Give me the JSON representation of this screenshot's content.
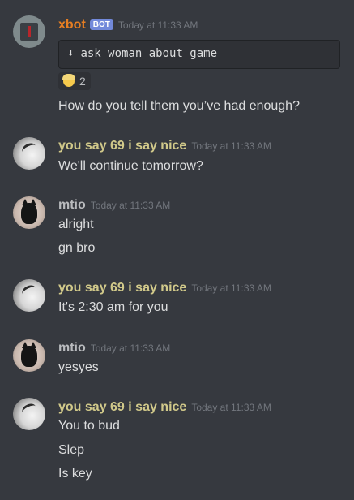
{
  "colors": {
    "background": "#36393f",
    "bot_name": "#e67e22",
    "user_name": "#d1c98a",
    "mtio_name": "#b9bbbe",
    "bot_tag": "#7289da",
    "timestamp": "#72767d"
  },
  "messages": [
    {
      "author": "xbot",
      "bot_tag": "BOT",
      "timestamp": "Today at 11:33 AM",
      "avatar_icon": "xbot-avatar",
      "codeblock": "ask woman about game",
      "codeblock_icon": "down-arrow-icon",
      "reaction": {
        "emoji_icon": "person-blonde-hair-emoji",
        "count": "2"
      },
      "lines": [
        "How do you tell them you’ve had enough?"
      ]
    },
    {
      "author": "you say 69 i say nice",
      "timestamp": "Today at 11:33 AM",
      "avatar_icon": "sheep-avatar",
      "lines": [
        "We'll continue tomorrow?"
      ]
    },
    {
      "author": "mtio",
      "timestamp": "Today at 11:33 AM",
      "avatar_icon": "cat-avatar",
      "lines": [
        "alright",
        "gn bro"
      ]
    },
    {
      "author": "you say 69 i say nice",
      "timestamp": "Today at 11:33 AM",
      "avatar_icon": "sheep-avatar",
      "lines": [
        "It's  2:30 am for you"
      ]
    },
    {
      "author": "mtio",
      "timestamp": "Today at 11:33 AM",
      "avatar_icon": "cat-avatar",
      "lines": [
        "yesyes"
      ]
    },
    {
      "author": "you say 69 i say nice",
      "timestamp": "Today at 11:33 AM",
      "avatar_icon": "sheep-avatar",
      "lines": [
        "You to bud",
        "Slep",
        "Is key"
      ]
    }
  ]
}
